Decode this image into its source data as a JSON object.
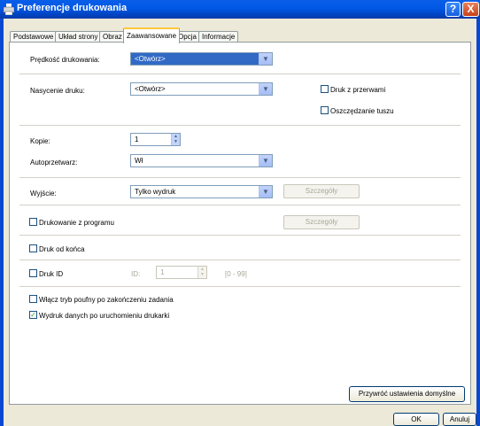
{
  "window": {
    "title": "Preferencje drukowania"
  },
  "tabs": [
    "Podstawowe",
    "Układ strony",
    "Obraz",
    "Zaawansowane",
    "Opcja",
    "Informacje"
  ],
  "active_tab": "Zaawansowane",
  "fields": {
    "speed": {
      "label": "Prędkość drukowania:",
      "value": "<Otwórz>"
    },
    "saturation": {
      "label": "Nasycenie druku:",
      "value": "<Otwórz>"
    },
    "copies": {
      "label": "Kopie:",
      "value": "1"
    },
    "auto_rotate": {
      "label": "Autoprzetwarz:",
      "value": "Wł"
    },
    "output": {
      "label": "Wyjście:",
      "value": "Tylko wydruk",
      "details": "Szczegóły"
    }
  },
  "checkboxes": {
    "gap_print": {
      "label": "Druk z przerwami",
      "checked": false
    },
    "ink_saving": {
      "label": "Oszczędzanie tuszu",
      "checked": false
    },
    "print_from_program": {
      "label": "Drukowanie z programu",
      "checked": false,
      "details": "Szczegóły"
    },
    "reverse_print": {
      "label": "Druk od końca",
      "checked": false
    },
    "print_id": {
      "label": "Druk ID",
      "checked": false,
      "id_label": "ID:",
      "id_value": "1",
      "range": "[0 - 99]"
    },
    "confidential": {
      "label": "Włącz tryb poufny po zakończeniu zadania",
      "checked": false
    },
    "startup_print": {
      "label": "Wydruk danych po uruchomieniu drukarki",
      "checked": true
    }
  },
  "buttons": {
    "restore_defaults": "Przywróć ustawienia domyślne",
    "ok": "OK",
    "cancel": "Anuluj",
    "help": "?",
    "close": "X"
  },
  "glyphs": {
    "dropdown": "▼",
    "up": "▲",
    "down": "▼",
    "check": "✓"
  },
  "colors": {
    "titlebar": "#0058e6",
    "tab_highlight": "#ffc83c",
    "selection": "#316ac5"
  }
}
